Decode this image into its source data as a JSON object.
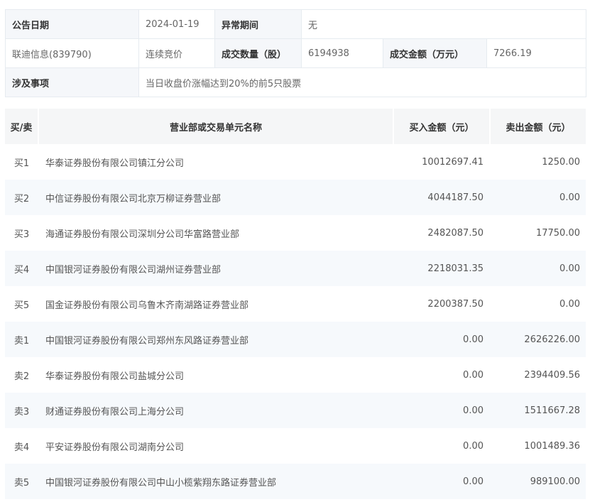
{
  "info": {
    "announce_date_label": "公告日期",
    "announce_date": "2024-01-19",
    "abnormal_period_label": "异常期间",
    "abnormal_period": "无",
    "stock": "联迪信息(839790)",
    "trade_method": "连续竞价",
    "volume_label": "成交数量（股）",
    "volume": "6194938",
    "amount_label": "成交金额（万元）",
    "amount": "7266.19",
    "matter_label": "涉及事项",
    "matter": "当日收盘价涨幅达到20%的前5只股票"
  },
  "table": {
    "headers": [
      "买/卖",
      "营业部或交易单元名称",
      "买入金额（元）",
      "卖出金额（元）"
    ],
    "rows": [
      {
        "side": "买1",
        "name": "华泰证券股份有限公司镇江分公司",
        "buy": "10012697.41",
        "sell": "1250.00"
      },
      {
        "side": "买2",
        "name": "中信证券股份有限公司北京万柳证券营业部",
        "buy": "4044187.50",
        "sell": "0.00"
      },
      {
        "side": "买3",
        "name": "海通证券股份有限公司深圳分公司华富路营业部",
        "buy": "2482087.50",
        "sell": "17750.00"
      },
      {
        "side": "买4",
        "name": "中国银河证券股份有限公司湖州证券营业部",
        "buy": "2218031.35",
        "sell": "0.00"
      },
      {
        "side": "买5",
        "name": "国金证券股份有限公司乌鲁木齐南湖路证券营业部",
        "buy": "2200387.50",
        "sell": "0.00"
      },
      {
        "side": "卖1",
        "name": "中国银河证券股份有限公司郑州东风路证券营业部",
        "buy": "0.00",
        "sell": "2626226.00"
      },
      {
        "side": "卖2",
        "name": "华泰证券股份有限公司盐城分公司",
        "buy": "0.00",
        "sell": "2394409.56"
      },
      {
        "side": "卖3",
        "name": "财通证券股份有限公司上海分公司",
        "buy": "0.00",
        "sell": "1511667.28"
      },
      {
        "side": "卖4",
        "name": "平安证券股份有限公司湖南分公司",
        "buy": "0.00",
        "sell": "1001489.36"
      },
      {
        "side": "卖5",
        "name": "中国银河证券股份有限公司中山小榄紫翔东路证券营业部",
        "buy": "0.00",
        "sell": "989100.00"
      }
    ]
  }
}
